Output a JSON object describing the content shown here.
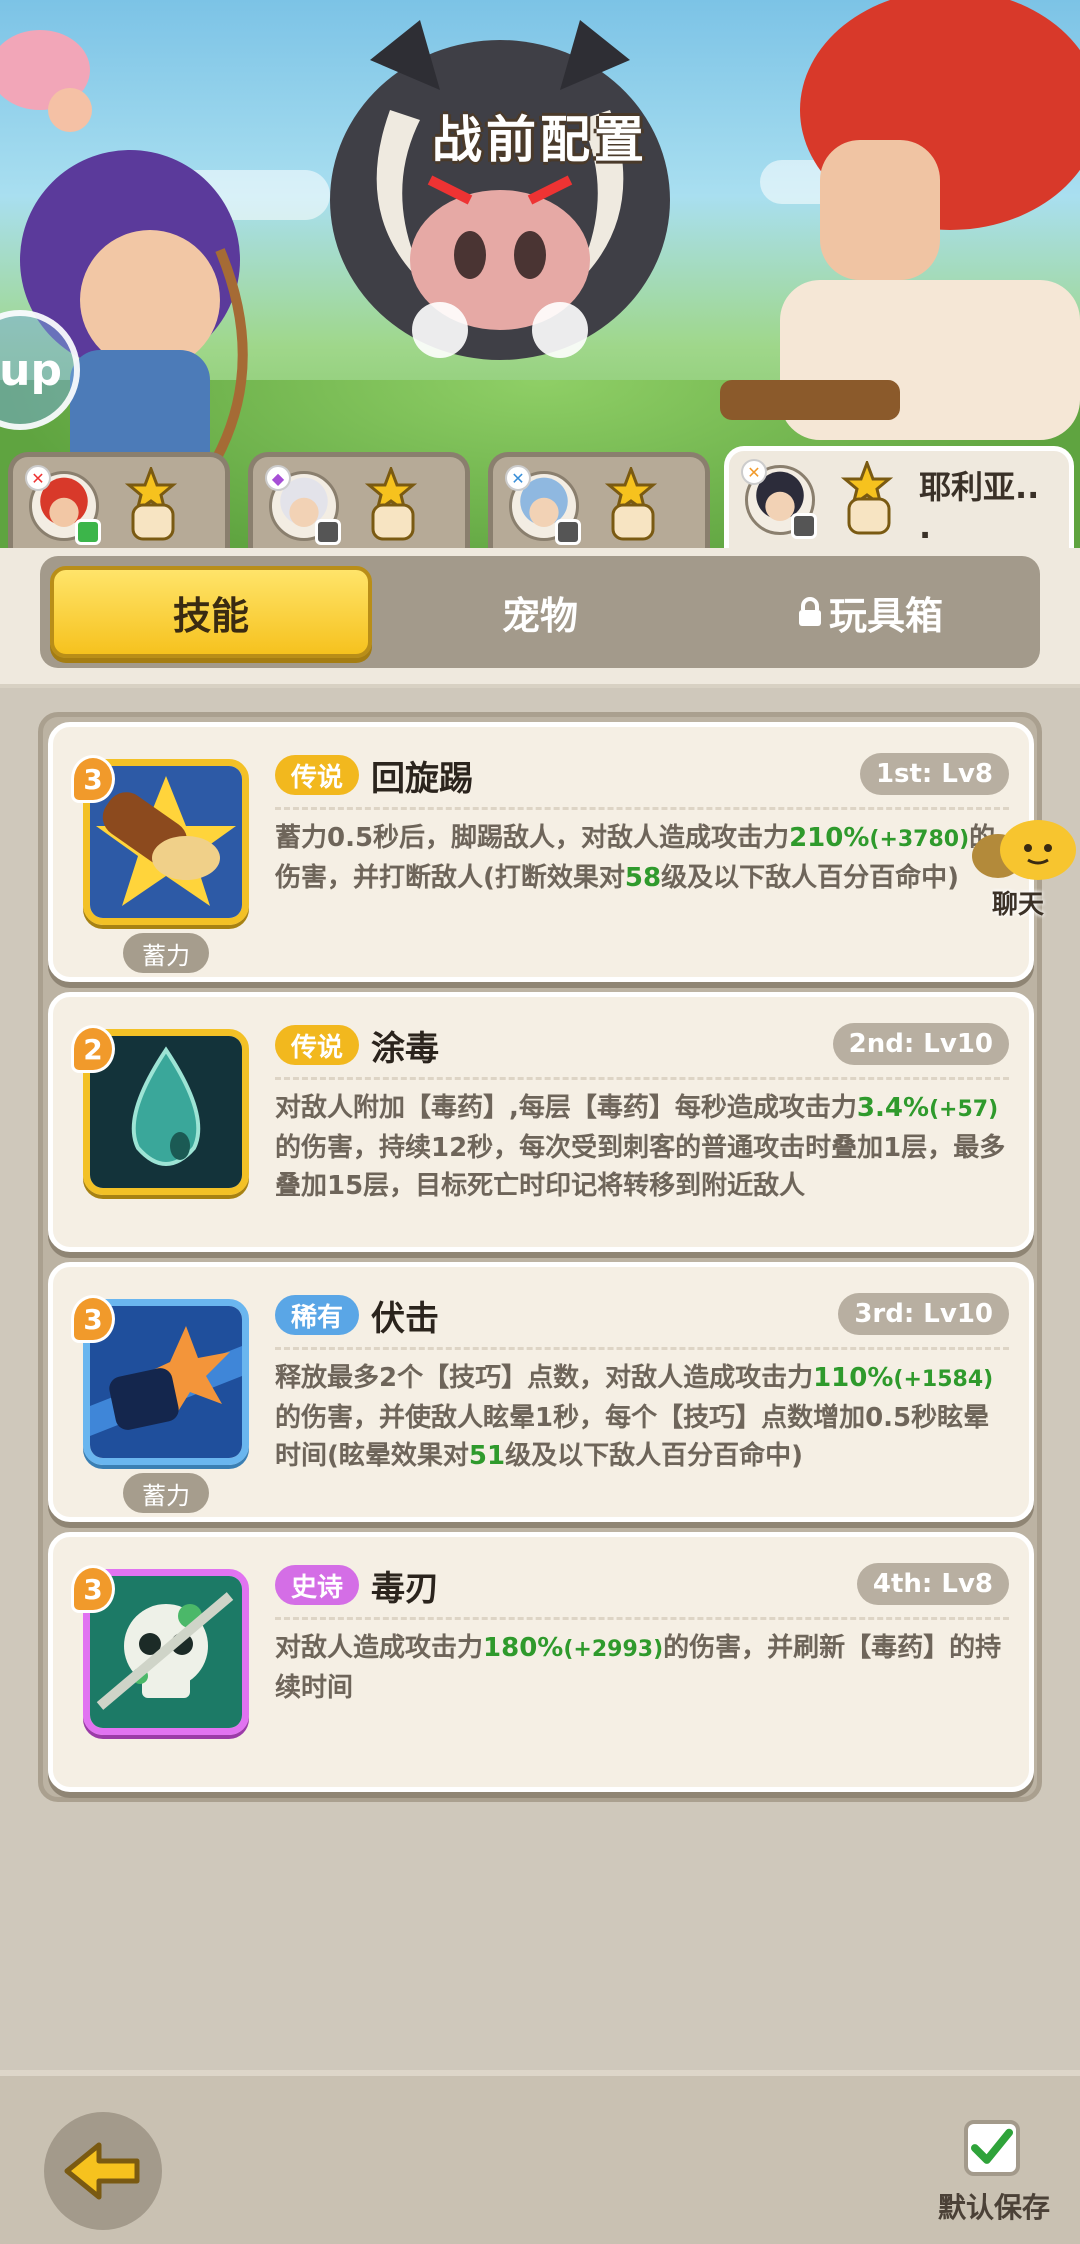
{
  "header": {
    "title": "战前配置",
    "up_label": "up"
  },
  "hero_tabs": [
    {
      "id": "hero1",
      "name": "",
      "active": false
    },
    {
      "id": "hero2",
      "name": "",
      "active": false
    },
    {
      "id": "hero3",
      "name": "",
      "active": false
    },
    {
      "id": "hero4",
      "name": "耶利亚..\n.",
      "active": true
    }
  ],
  "sections": {
    "skills": "技能",
    "pets": "宠物",
    "toybox": "玩具箱"
  },
  "skills": [
    {
      "level_badge": "3",
      "rarity": "传说",
      "name": "回旋踢",
      "slot": "1st: Lv8",
      "charge_label": "蓄力",
      "desc": [
        "蓄力0.5秒后，脚踢敌人，对敌人造成攻击力",
        "210%",
        "(+3780)",
        "的伤害，并打断敌人(打断效果对",
        "58",
        "级及以下敌人百分百命中)"
      ]
    },
    {
      "level_badge": "2",
      "rarity": "传说",
      "name": "涂毒",
      "slot": "2nd: Lv10",
      "charge_label": "",
      "desc": [
        "对敌人附加【毒药】,每层【毒药】每秒造成攻击力",
        "3.4%",
        "(+57)",
        "的伤害，持续12秒，每次受到刺客的普通攻击时叠加1层，最多叠加15层，目标死亡时印记将转移到附近敌人"
      ]
    },
    {
      "level_badge": "3",
      "rarity": "稀有",
      "name": "伏击",
      "slot": "3rd: Lv10",
      "charge_label": "蓄力",
      "desc": [
        "释放最多2个【技巧】点数，对敌人造成攻击力",
        "110%",
        "(+1584)",
        "的伤害，并使敌人眩晕1秒，每个【技巧】点数增加0.5秒眩晕时间(眩晕效果对",
        "51",
        "级及以下敌人百分百命中)"
      ]
    },
    {
      "level_badge": "3",
      "rarity": "史诗",
      "name": "毒刃",
      "slot": "4th: Lv8",
      "charge_label": "",
      "desc": [
        "对敌人造成攻击力",
        "180%",
        "(+2993)",
        "的伤害，并刷新【毒药】的持续时间"
      ]
    }
  ],
  "chat": {
    "label": "聊天"
  },
  "footer": {
    "save_label": "默认保存"
  },
  "colors": {
    "accent_yellow": "#f6c21e",
    "value_green": "#2f9a2c",
    "legend": "#f2b81e",
    "rare": "#5aa6e6",
    "epic": "#d46ee6"
  }
}
